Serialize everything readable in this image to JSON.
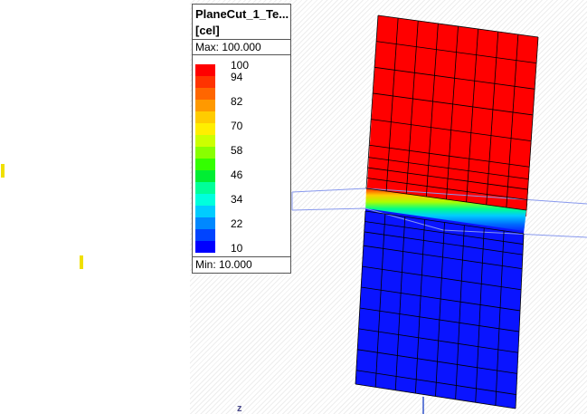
{
  "legend": {
    "title": "PlaneCut_1_Te...",
    "unit": "[cel]",
    "max_label": "Max: 100.000",
    "min_label": "Min:  10.000",
    "ticks": [
      "100",
      "94",
      "82",
      "70",
      "58",
      "46",
      "34",
      "22",
      "10"
    ],
    "colors": [
      "#ff0000",
      "#ff3300",
      "#ff6600",
      "#ff9900",
      "#ffcc00",
      "#ffee00",
      "#ccff00",
      "#88ff00",
      "#33ff00",
      "#00ee33",
      "#00ff99",
      "#00ffdd",
      "#00ccff",
      "#0088ff",
      "#0044ff",
      "#0000ff"
    ]
  },
  "viewport": {
    "axis_label": "z",
    "hot_color": "#ff0000",
    "cold_color": "#0a14ff",
    "grid_color": "#000000",
    "plane_color": "#8899ee"
  }
}
